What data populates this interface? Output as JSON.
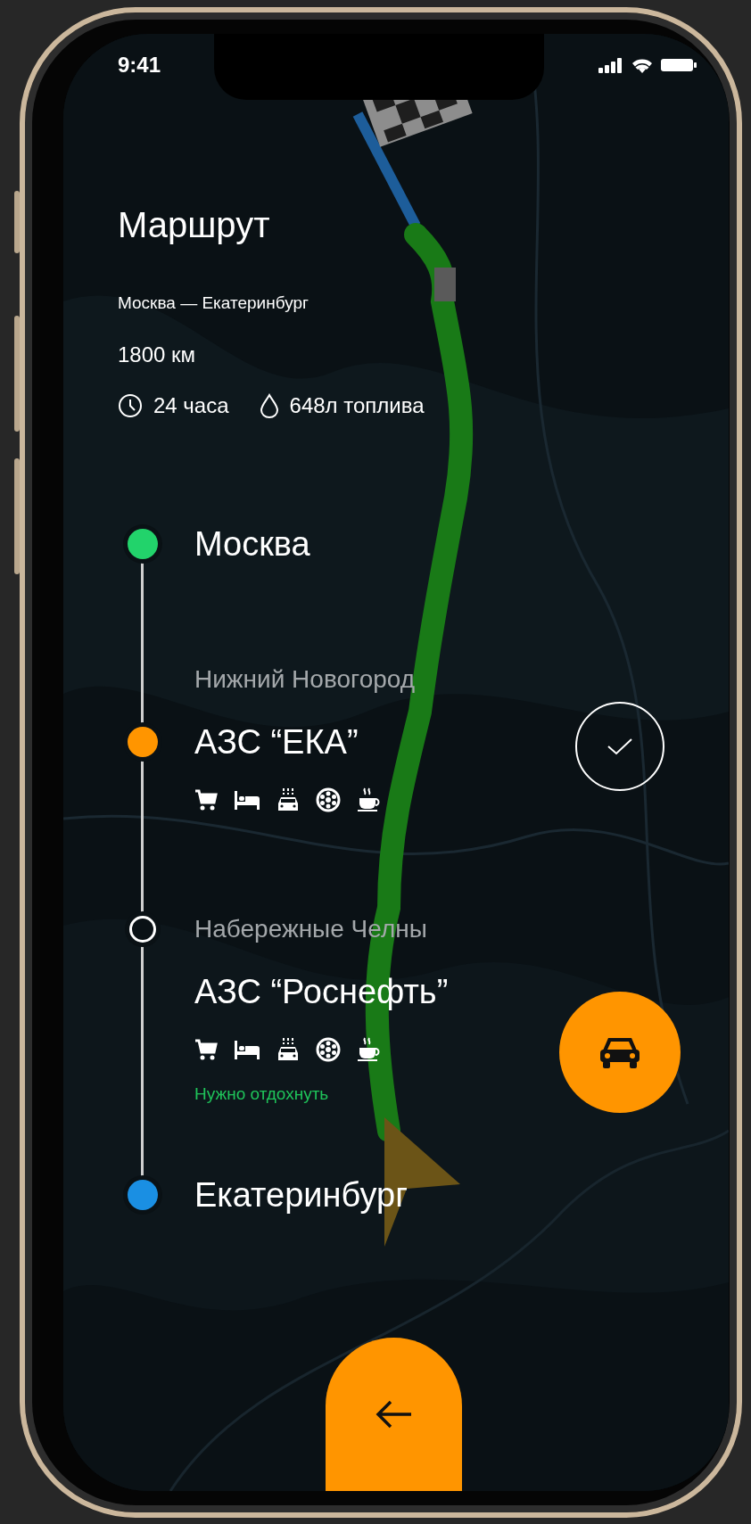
{
  "status_bar": {
    "time": "9:41"
  },
  "title": "Маршрут",
  "route": "Москва — Екатеринбург",
  "distance": "1800 км",
  "stats": [
    {
      "kind": "time",
      "text": "24 часа"
    },
    {
      "kind": "fuel",
      "text": "648л топлива"
    }
  ],
  "stops": [
    {
      "kind": "city",
      "name": "Москва",
      "color": "#22d36b"
    },
    {
      "kind": "station",
      "area": "Нижний Новогород",
      "name": "АЗС “ЕКА”",
      "hollow": false,
      "color": "#ff9500"
    },
    {
      "kind": "station",
      "area": "Набережные Челны",
      "name": "АЗС “Роснефть”",
      "hollow": true,
      "note": "Нужно отдохнуть"
    },
    {
      "kind": "city",
      "name": "Екатеринбург",
      "color": "#1a8fe3"
    }
  ]
}
